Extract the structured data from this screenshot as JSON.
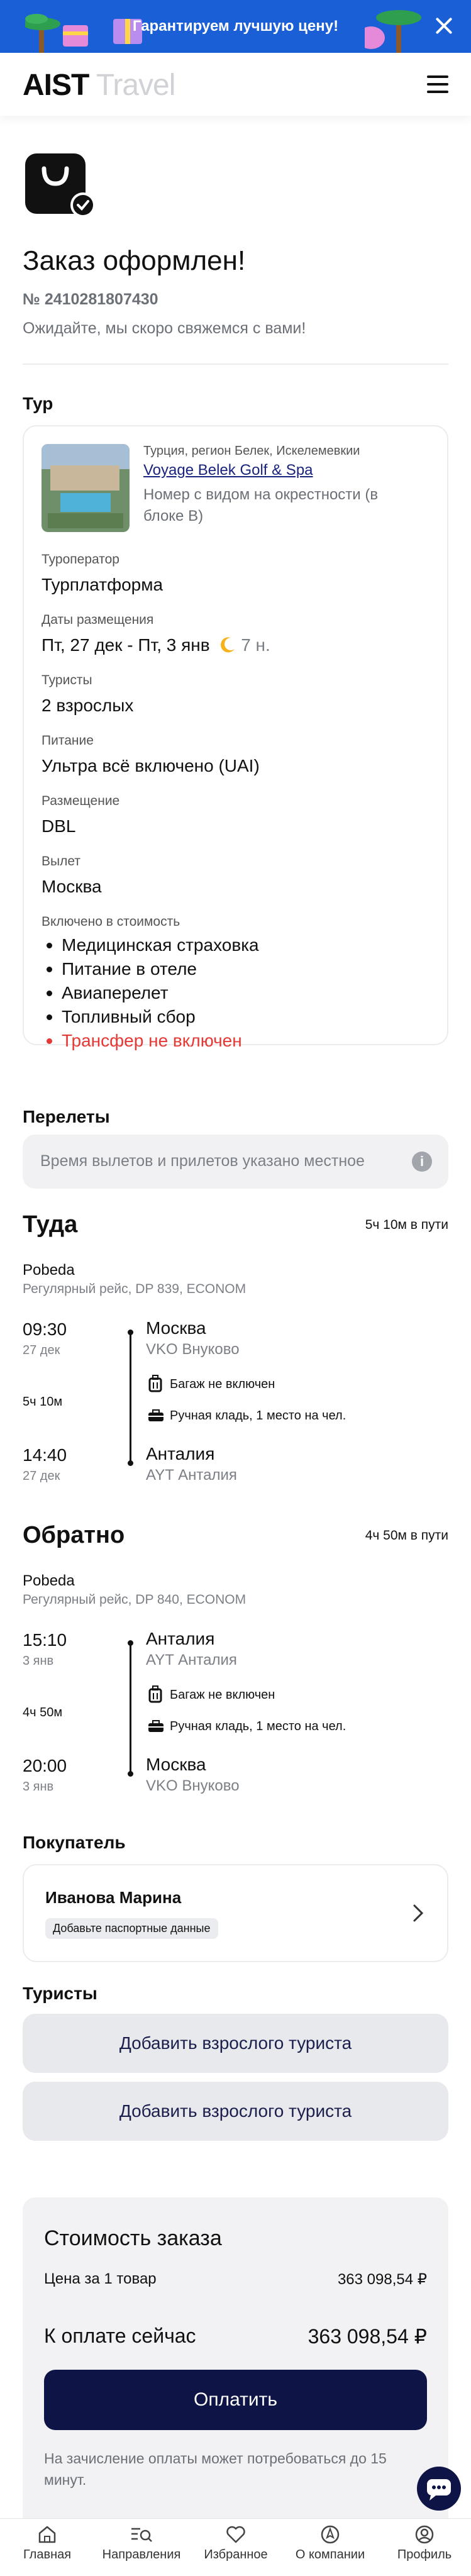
{
  "promo": {
    "text": "Гарантируем лучшую цену!"
  },
  "header": {
    "logo_main": "AIST",
    "logo_sub": "Travel"
  },
  "order": {
    "title": "Заказ оформлен!",
    "number": "№ 2410281807430",
    "message": "Ожидайте, мы скоро свяжемся с вами!"
  },
  "tour": {
    "section_title": "Тур",
    "location": "Турция, регион Белек, Искелемевкии",
    "hotel_name": "Voyage Belek Golf & Spa",
    "room": "Номер с видом на окрестности (в блоке B)",
    "operator_label": "Туроператор",
    "operator": "Турплатформа",
    "dates_label": "Даты размещения",
    "dates": "Пт, 27 дек - Пт, 3 янв",
    "nights": "7 н.",
    "tourists_label": "Туристы",
    "tourists": "2 взрослых",
    "meal_label": "Питание",
    "meal": "Ультра всё включено (UAI)",
    "accommodation_label": "Размещение",
    "accommodation": "DBL",
    "departure_label": "Вылет",
    "departure": "Москва",
    "included_label": "Включено в стоимость",
    "included": [
      "Медицинская страховка",
      "Питание в отеле",
      "Авиаперелет",
      "Топливный сбор"
    ],
    "excluded": "Трансфер не включен"
  },
  "flights": {
    "section_title": "Перелеты",
    "notice": "Время вылетов и прилетов указано местное",
    "there": {
      "title": "Туда",
      "duration_total": "5ч 10м в пути",
      "airline": "Pobeda",
      "details": "Регулярный рейс, DP 839, ECONOM",
      "dep_time": "09:30",
      "dep_date": "27 дек",
      "dep_city": "Москва",
      "dep_airport": "VKO Внуково",
      "duration": "5ч 10м",
      "baggage": "Багаж не включен",
      "hand_luggage": "Ручная кладь, 1 место на чел.",
      "arr_time": "14:40",
      "arr_date": "27 дек",
      "arr_city": "Анталия",
      "arr_airport": "AYT Анталия"
    },
    "back": {
      "title": "Обратно",
      "duration_total": "4ч 50м в пути",
      "airline": "Pobeda",
      "details": "Регулярный рейс, DP 840, ECONOM",
      "dep_time": "15:10",
      "dep_date": "3 янв",
      "dep_city": "Анталия",
      "dep_airport": "AYT Анталия",
      "duration": "4ч 50м",
      "baggage": "Багаж не включен",
      "hand_luggage": "Ручная кладь, 1 место на чел.",
      "arr_time": "20:00",
      "arr_date": "3 янв",
      "arr_city": "Москва",
      "arr_airport": "VKO Внуково"
    }
  },
  "buyer": {
    "section_title": "Покупатель",
    "name": "Иванова Марина",
    "passport_badge": "Добавьте паспортные данные"
  },
  "tourists": {
    "section_title": "Туристы",
    "add_button_1": "Добавить взрослого туриста",
    "add_button_2": "Добавить взрослого туриста"
  },
  "summary": {
    "title": "Стоимость заказа",
    "unit_price_label": "Цена за 1 товар",
    "unit_price": "363 098,54 ₽",
    "pay_now_label": "К оплате сейчас",
    "pay_now": "363 098,54 ₽",
    "pay_button": "Оплатить",
    "note": "На зачисление оплаты может потребоваться до 15 минут."
  },
  "tabbar": {
    "home": "Главная",
    "directions": "Направления",
    "favorites": "Избранное",
    "about": "О компании",
    "profile": "Профиль"
  },
  "colors": {
    "accent": "#0e1445",
    "promo": "#1b5fd6",
    "error": "#e53935",
    "link": "#1a237e"
  }
}
